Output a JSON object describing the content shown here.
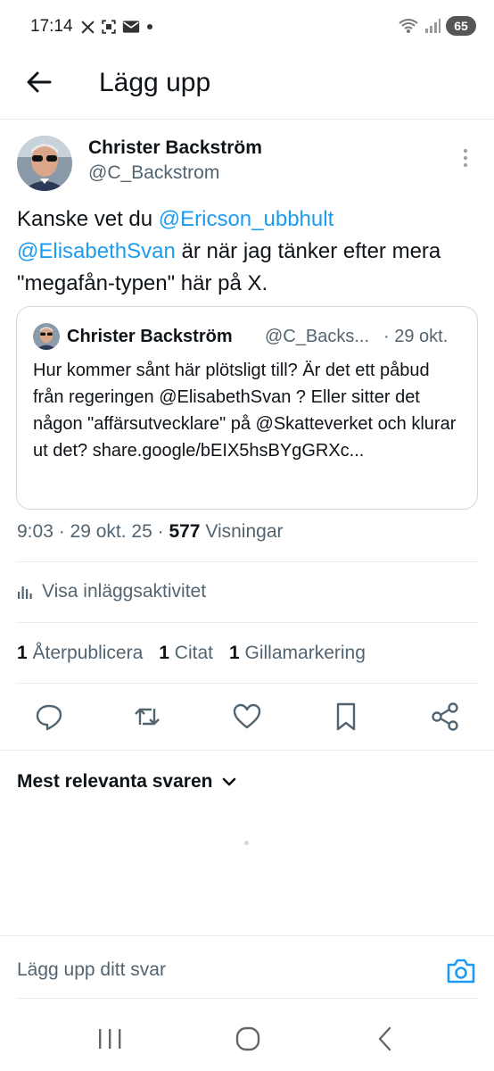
{
  "status_bar": {
    "time": "17:14",
    "battery": "65",
    "icons": [
      "x-logo-icon",
      "screenshot-icon",
      "mail-icon",
      "dot-icon",
      "wifi-icon",
      "signal-icon"
    ]
  },
  "header": {
    "title": "Lägg upp"
  },
  "post": {
    "author_name": "Christer Backström",
    "author_handle": "@C_Backstrom",
    "text_parts": {
      "p1": "Kanske vet du ",
      "mention1": "@Ericson_ubbhult",
      "mention2": "@ElisabethSvan",
      "p2": " är när jag tänker efter mera  \"megafån-typen\" här på  X."
    },
    "quote": {
      "author_name": "Christer Backström",
      "author_handle": "@C_Backs...",
      "date": "· 29 okt.",
      "text": "Hur kommer sånt här plötsligt till? Är det ett påbud från regeringen @ElisabethSvan ? Eller sitter det någon \"affärsutvecklare\" på @Skatteverket och klurar ut det?  share.google/bEIX5hsBYgGRXc..."
    },
    "meta_time": "9:03 · 29 okt. 25 · ",
    "views_count": "577",
    "views_label": " Visningar",
    "activity_label": "Visa inläggsaktivitet",
    "stats": {
      "reposts_count": "1",
      "reposts_label": "Återpublicera",
      "quotes_count": "1",
      "quotes_label": "Citat",
      "likes_count": "1",
      "likes_label": "Gillamarkering"
    }
  },
  "replies": {
    "sort_label": "Mest relevanta svaren"
  },
  "composer": {
    "placeholder": "Lägg upp ditt svar"
  },
  "colors": {
    "accent": "#1d9bf0",
    "text": "#0f1419",
    "muted": "#536471",
    "border": "#cfd9de"
  }
}
